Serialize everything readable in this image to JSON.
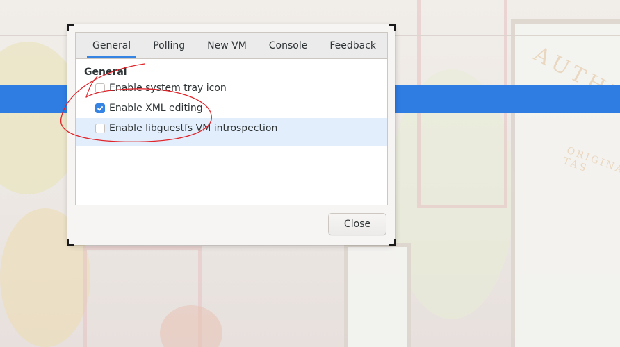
{
  "dialog": {
    "tabs": [
      {
        "label": "General",
        "active": true
      },
      {
        "label": "Polling",
        "active": false
      },
      {
        "label": "New VM",
        "active": false
      },
      {
        "label": "Console",
        "active": false
      },
      {
        "label": "Feedback",
        "active": false
      }
    ],
    "section_title": "General",
    "options": [
      {
        "label": "Enable system tray icon",
        "checked": false
      },
      {
        "label": "Enable XML editing",
        "checked": true
      },
      {
        "label": "Enable libguestfs VM introspection",
        "checked": false
      }
    ],
    "close_label": "Close"
  },
  "wallpaper": {
    "sign_text": "AUTHEN",
    "sign_sub_text": "ORIGINAL TAS"
  },
  "colors": {
    "accent": "#3584e4",
    "selection_bar": "#2f7de2",
    "annotation_ink": "#e0242a"
  }
}
